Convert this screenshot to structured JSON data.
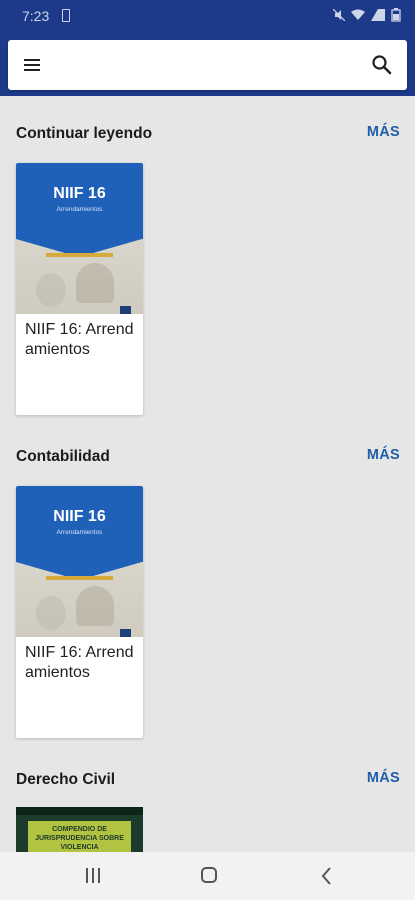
{
  "status_bar": {
    "time": "7:23"
  },
  "app_bar": {
    "menu_icon": "menu-icon",
    "search_icon": "search-icon"
  },
  "sections": [
    {
      "title": "Continuar leyendo",
      "more": "MÁS",
      "books": [
        {
          "title": "NIIF 16: Arrendamientos",
          "cover_title": "NIIF 16",
          "cover_subtitle": "Arrendamientos"
        }
      ]
    },
    {
      "title": "Contabilidad",
      "more": "MÁS",
      "books": [
        {
          "title": "NIIF 16: Arrendamientos",
          "cover_title": "NIIF 16",
          "cover_subtitle": "Arrendamientos"
        }
      ]
    },
    {
      "title": "Derecho Civil",
      "more": "MÁS",
      "books": [
        {
          "cover_text": "COMPENDIO DE JURISPRUDENCIA SOBRE VIOLENCIA"
        }
      ]
    }
  ],
  "colors": {
    "primary": "#1d3a8a",
    "accent": "#1f5fa8",
    "cover_blue": "#1f60b8",
    "cover_gold": "#d6a93b"
  }
}
